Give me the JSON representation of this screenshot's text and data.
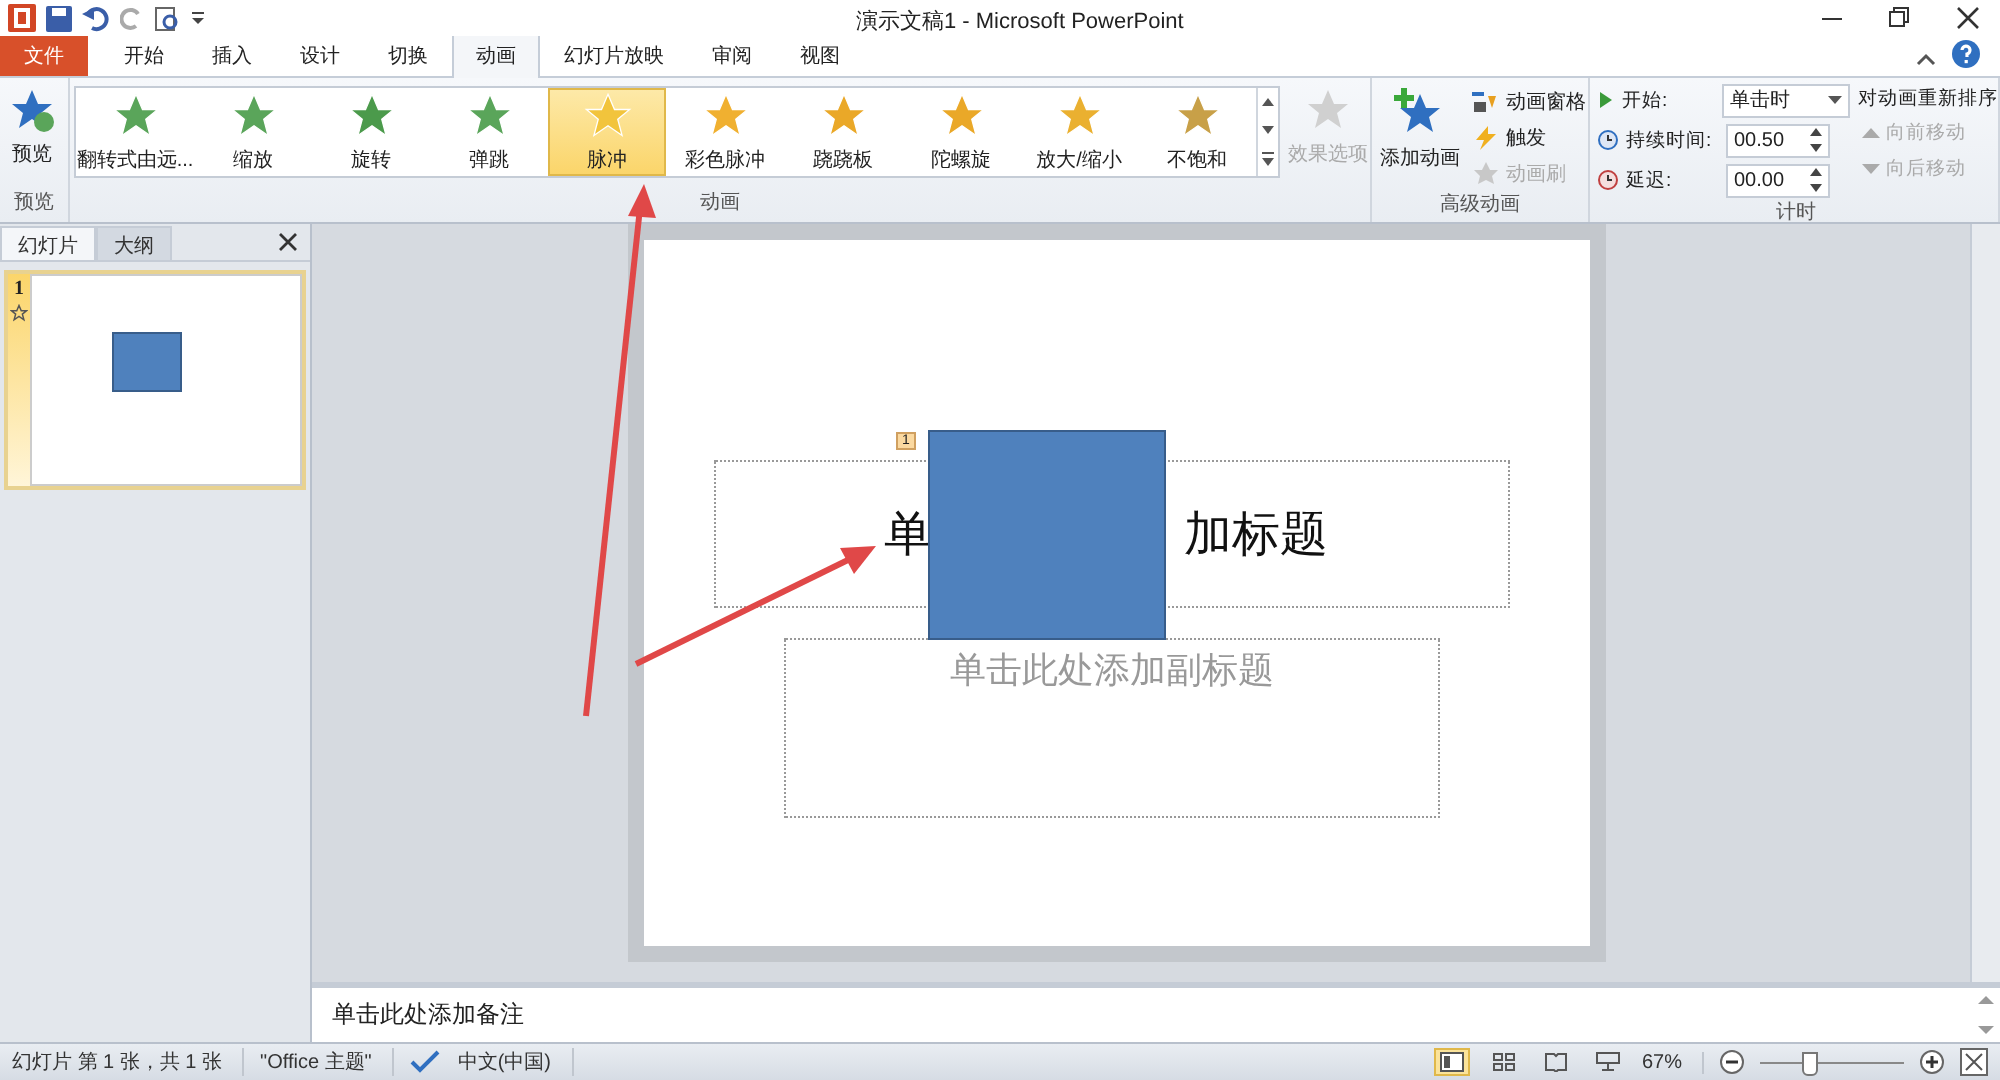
{
  "window": {
    "title": "演示文稿1 - Microsoft PowerPoint"
  },
  "tabs": [
    {
      "label": "文件",
      "kind": "file",
      "selected": false
    },
    {
      "label": "开始",
      "kind": "tab",
      "selected": false
    },
    {
      "label": "插入",
      "kind": "tab",
      "selected": false
    },
    {
      "label": "设计",
      "kind": "tab",
      "selected": false
    },
    {
      "label": "切换",
      "kind": "tab",
      "selected": false
    },
    {
      "label": "动画",
      "kind": "tab",
      "selected": true
    },
    {
      "label": "幻灯片放映",
      "kind": "tab",
      "selected": false
    },
    {
      "label": "审阅",
      "kind": "tab",
      "selected": false
    },
    {
      "label": "视图",
      "kind": "tab",
      "selected": false
    }
  ],
  "ribbon": {
    "preview": {
      "label": "预览",
      "group": "预览"
    },
    "gallery": {
      "group": "动画",
      "items": [
        {
          "label": "翻转式由远...",
          "color": "#5aa55a",
          "selected": false
        },
        {
          "label": "缩放",
          "color": "#5aa55a",
          "selected": false
        },
        {
          "label": "旋转",
          "color": "#4b9a4b",
          "selected": false
        },
        {
          "label": "弹跳",
          "color": "#5aa55a",
          "selected": false
        },
        {
          "label": "脉冲",
          "color": "#f2c43c",
          "selected": true
        },
        {
          "label": "彩色脉冲",
          "color": "#f0b030",
          "selected": false
        },
        {
          "label": "跷跷板",
          "color": "#eaa828",
          "selected": false
        },
        {
          "label": "陀螺旋",
          "color": "#eaa828",
          "selected": false
        },
        {
          "label": "放大/缩小",
          "color": "#eab030",
          "selected": false
        },
        {
          "label": "不饱和",
          "color": "#c8a048",
          "selected": false
        }
      ]
    },
    "effect_options": {
      "label": "效果选项",
      "disabled": true
    },
    "advanced": {
      "group": "高级动画",
      "add": "添加动画",
      "items": [
        {
          "label": "动画窗格",
          "kind": "pane",
          "disabled": false
        },
        {
          "label": "触发",
          "kind": "trigger",
          "disabled": false
        },
        {
          "label": "动画刷",
          "kind": "painter",
          "disabled": true
        }
      ]
    },
    "timing": {
      "group": "计时",
      "start_label": "开始:",
      "start_value": "单击时",
      "duration_label": "持续时间:",
      "duration_value": "00.50",
      "delay_label": "延迟:",
      "delay_value": "00.00",
      "reorder_title": "对动画重新排序",
      "moves": [
        {
          "label": "向前移动",
          "kind": "up",
          "disabled": true
        },
        {
          "label": "向后移动",
          "kind": "down",
          "disabled": true
        }
      ]
    }
  },
  "panel": {
    "tabs": [
      {
        "label": "幻灯片",
        "selected": true
      },
      {
        "label": "大纲",
        "selected": false
      }
    ],
    "thumbnails": [
      {
        "number": "1",
        "selected": true
      }
    ]
  },
  "slide": {
    "animation_tag": "1",
    "title_parts": [
      "单",
      "加标题"
    ],
    "subtitle_placeholder": "单击此处添加副标题"
  },
  "notes": {
    "placeholder": "单击此处添加备注"
  },
  "status_bar": {
    "slide_info": "幻灯片 第 1 张，共 1 张",
    "theme": "\"Office 主题\"",
    "language": "中文(中国)",
    "zoom": "67%",
    "views": [
      {
        "kind": "normal",
        "selected": true
      },
      {
        "kind": "sorter",
        "selected": false
      },
      {
        "kind": "reading",
        "selected": false
      },
      {
        "kind": "show",
        "selected": false
      }
    ],
    "zoom_slider": {
      "level": 0.33
    }
  }
}
